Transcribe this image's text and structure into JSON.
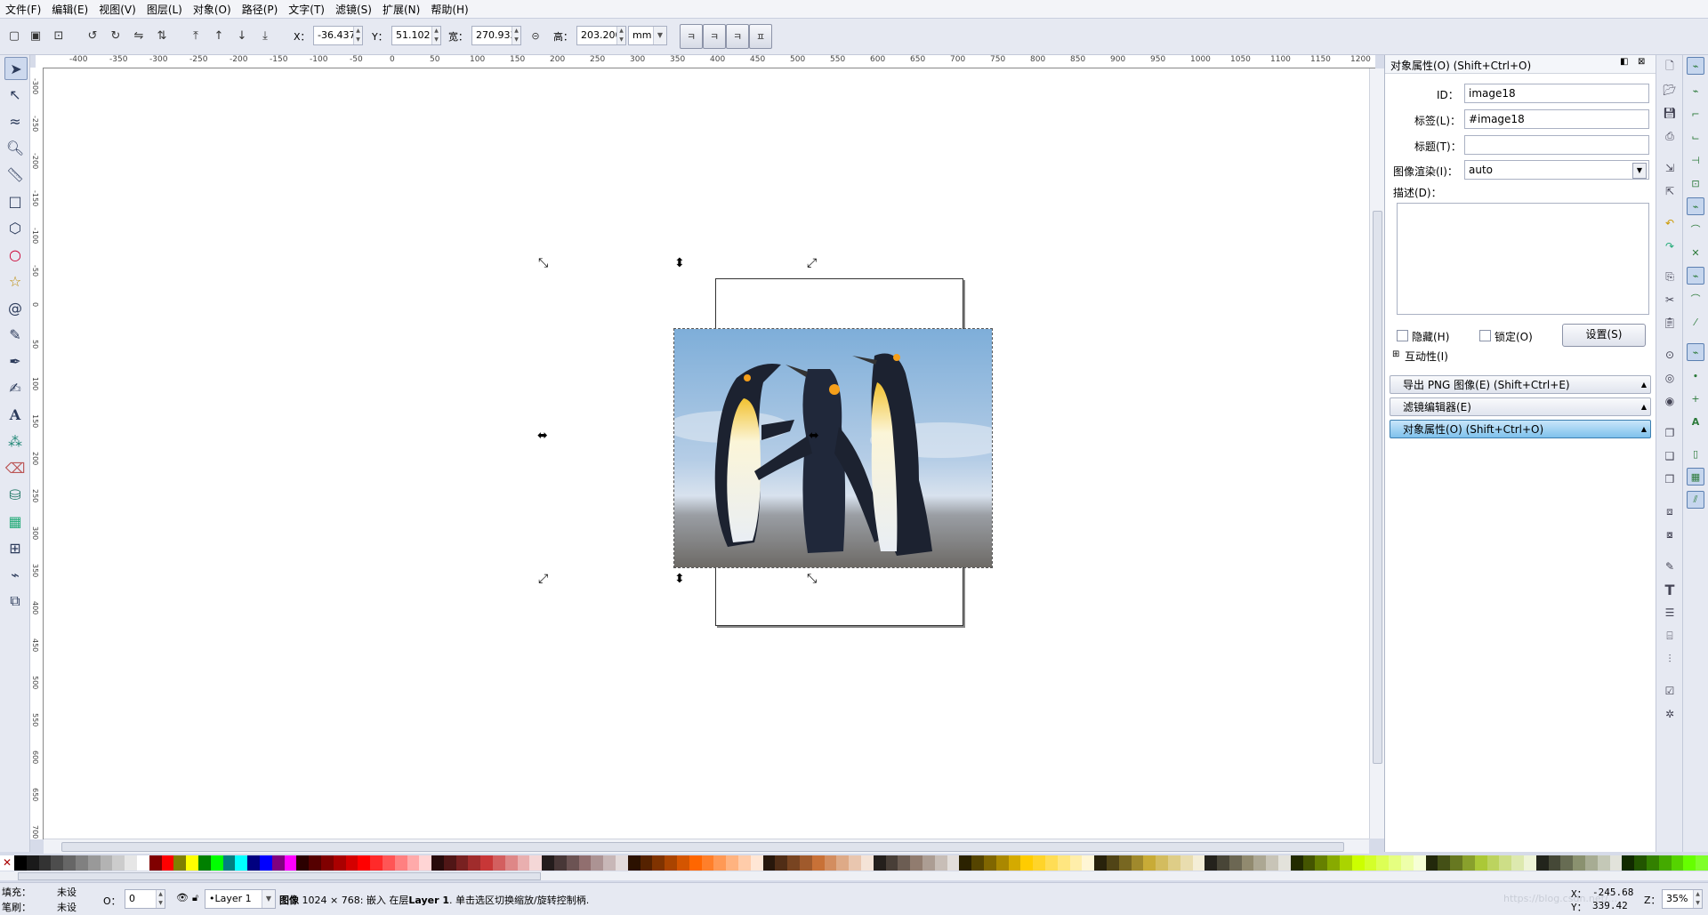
{
  "menu": [
    "文件(F)",
    "编辑(E)",
    "视图(V)",
    "图层(L)",
    "对象(O)",
    "路径(P)",
    "文字(T)",
    "滤镜(S)",
    "扩展(N)",
    "帮助(H)"
  ],
  "toolbar": {
    "x_label": "X：",
    "x_value": "-36.437",
    "y_label": "Y：",
    "y_value": "51.102",
    "w_label": "宽：",
    "w_value": "270.933",
    "h_label": "高：",
    "h_value": "203.200",
    "unit": "mm"
  },
  "hruler_ticks": [
    "-400",
    "-350",
    "-300",
    "-250",
    "-200",
    "-150",
    "-100",
    "-50",
    "0",
    "50",
    "100",
    "150",
    "200",
    "250",
    "300",
    "350",
    "400",
    "450",
    "500",
    "550",
    "600",
    "650",
    "700",
    "750",
    "800",
    "850",
    "900",
    "950",
    "1000",
    "1050",
    "1100",
    "1150",
    "1200"
  ],
  "vruler_ticks": [
    "-300",
    "-250",
    "-200",
    "-150",
    "-100",
    "-50",
    "0",
    "50",
    "100",
    "150",
    "200",
    "250",
    "300",
    "350",
    "400",
    "450",
    "500",
    "550",
    "600",
    "650",
    "700"
  ],
  "panel": {
    "title": "对象属性(O) (Shift+Ctrl+O)",
    "id_label": "ID：",
    "id_value": "image18",
    "tag_label": "标签(L)：",
    "tag_value": "#image18",
    "title_label": "标题(T)：",
    "title_value": "",
    "render_label": "图像渲染(I)：",
    "render_value": "auto",
    "desc_label": "描述(D)：",
    "hide_label": "隐藏(H)",
    "lock_label": "锁定(O)",
    "set_button": "设置(S)",
    "interactivity_label": "互动性(I)",
    "sections": [
      "导出 PNG 图像(E) (Shift+Ctrl+E)",
      "滤镜编辑器(E)",
      "对象属性(O) (Shift+Ctrl+O)"
    ]
  },
  "palette": [
    "#000000",
    "#1a1a1a",
    "#333333",
    "#4d4d4d",
    "#666666",
    "#808080",
    "#999999",
    "#b3b3b3",
    "#cccccc",
    "#e6e6e6",
    "#ffffff",
    "#800000",
    "#ff0000",
    "#808000",
    "#ffff00",
    "#008000",
    "#00ff00",
    "#008080",
    "#00ffff",
    "#000080",
    "#0000ff",
    "#800080",
    "#ff00ff",
    "#2b0000",
    "#550000",
    "#800000",
    "#aa0000",
    "#d40000",
    "#ff0000",
    "#ff2a2a",
    "#ff5555",
    "#ff8080",
    "#ffaaaa",
    "#ffd5d5",
    "#280b0b",
    "#501616",
    "#782121",
    "#a02c2c",
    "#c83737",
    "#d35f5f",
    "#de8787",
    "#e9afaf",
    "#f4d7d7",
    "#241c1c",
    "#483737",
    "#6c5353",
    "#916f6f",
    "#ac9393",
    "#c8b7b7",
    "#e3dbdb",
    "#2b1100",
    "#552200",
    "#803300",
    "#aa4400",
    "#d45500",
    "#ff6600",
    "#ff7f2a",
    "#ff9955",
    "#ffb380",
    "#ffccaa",
    "#ffe6d5",
    "#28170b",
    "#502d16",
    "#784421",
    "#a05a2c",
    "#c87137",
    "#d38d5f",
    "#deaa87",
    "#e9c6af",
    "#f4e3d7",
    "#241f1c",
    "#483e37",
    "#6c5d53",
    "#917c6f",
    "#ac9d93",
    "#c8beb7",
    "#e3dedb",
    "#2b2200",
    "#554400",
    "#806600",
    "#aa8800",
    "#d4aa00",
    "#ffcc00",
    "#ffd42a",
    "#ffdd55",
    "#ffe680",
    "#ffeeaa",
    "#fff6d5",
    "#28220b",
    "#504416",
    "#786721",
    "#a0892c",
    "#c8ab37",
    "#d3bc5f",
    "#decd87",
    "#e9ddaf",
    "#f4eed7",
    "#24221c",
    "#484537",
    "#6c6753",
    "#918a6f",
    "#aca793",
    "#c8c4b7",
    "#e3e2db",
    "#222b00",
    "#445500",
    "#668000",
    "#88aa00",
    "#aad400",
    "#ccff00",
    "#d4ff2a",
    "#ddff55",
    "#e5ff80",
    "#eeffaa",
    "#f6ffd5",
    "#22280b",
    "#445016",
    "#677821",
    "#89a02c",
    "#abc837",
    "#bcd35f",
    "#cdde87",
    "#dde9af",
    "#eef4d7",
    "#22241c",
    "#454837",
    "#676c53",
    "#8a916f",
    "#a7ac93",
    "#c4c8b7",
    "#e2e3db",
    "#112b00",
    "#225500",
    "#338000",
    "#44aa00",
    "#55d400",
    "#66ff00",
    "#7fff2a"
  ],
  "status": {
    "fill_label": "填充：",
    "fill_value": "未设",
    "stroke_label": "笔刷：",
    "stroke_value": "未设",
    "opacity_label": "O：",
    "opacity_value": "0",
    "layer": "•Layer 1",
    "message_bold": "图像",
    "message": " 1024 × 768: 嵌入 在层",
    "message_layer": "Layer 1",
    "message_tail": ". 单击选区切换缩放/旋转控制柄.",
    "coord_x_label": "X：",
    "coord_x": "-245.68",
    "coord_y_label": "Y：",
    "coord_y": "339.42",
    "zoom_label": "Z：",
    "zoom": "35%",
    "watermark": "https://blog.csdn.net/..."
  }
}
